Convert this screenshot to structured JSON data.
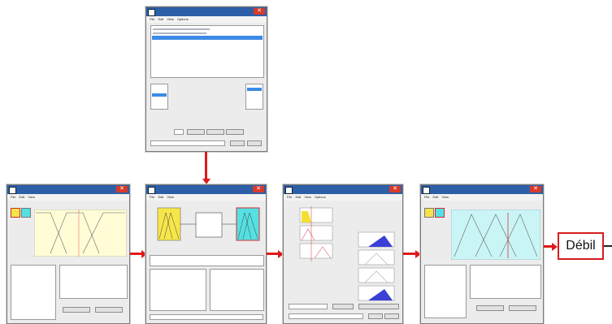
{
  "output": {
    "result_label": "Débil"
  },
  "top_window": {
    "menu": [
      "File",
      "Edit",
      "View",
      "Options"
    ]
  },
  "fis_editor": {
    "menu": [
      "File",
      "Edit",
      "View"
    ]
  },
  "mf_editor": {
    "menu": [
      "File",
      "Edit",
      "View"
    ]
  },
  "rule_viewer": {
    "menu": [
      "File",
      "Edit",
      "View",
      "Options"
    ]
  },
  "mf_editor_output": {
    "menu": [
      "File",
      "Edit",
      "View"
    ]
  },
  "colors": {
    "arrow": "#e0191b",
    "mf_input_bg": "#fffcd6",
    "mf_output_bg": "#c9f5f6",
    "titlebar": "#2d5fa8"
  },
  "icons": [
    "close-icon",
    "app-icon"
  ]
}
